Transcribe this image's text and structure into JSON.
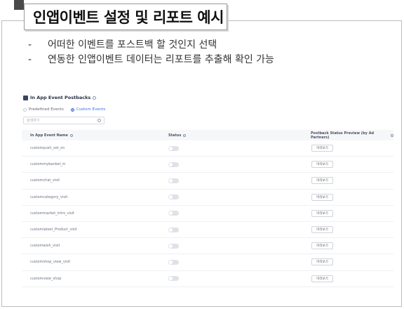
{
  "slide": {
    "title": "인앱이벤트 설정 및 리포트 예시",
    "bullets": [
      {
        "dash": "-",
        "text": "어떠한 이벤트를 포스트백 할 것인지 선택"
      },
      {
        "dash": "-",
        "text": "연동한 인앱이벤트 데이터는 리포트를 추출해 확인 가능"
      }
    ]
  },
  "panel": {
    "icon": "document-icon",
    "title": "In App Event Postbacks",
    "radios": [
      {
        "label": "Predefined Events",
        "selected": false
      },
      {
        "label": "Custom Events",
        "selected": true
      }
    ],
    "search_placeholder": "검색하기",
    "columns": {
      "name": "In App Event Name",
      "status": "Status",
      "preview": "Postback Status Preview (by Ad Partners)"
    },
    "preview_label": "미리보기",
    "rows": [
      {
        "name": "custompush_set_on",
        "status_on": false
      },
      {
        "name": "custommybanket_in",
        "status_on": false
      },
      {
        "name": "customchat_visit",
        "status_on": false
      },
      {
        "name": "customcategory_visit",
        "status_on": false
      },
      {
        "name": "custommarket_intro_visit",
        "status_on": false
      },
      {
        "name": "customlatest_Product_visit",
        "status_on": false
      },
      {
        "name": "customwish_visit",
        "status_on": false
      },
      {
        "name": "customshop_view_visit",
        "status_on": false
      },
      {
        "name": "customview_shop",
        "status_on": false
      }
    ]
  },
  "colors": {
    "accent": "#3a6fe6",
    "header_bg": "#f6f7f9",
    "toggle_off": "#dfe2e8"
  }
}
